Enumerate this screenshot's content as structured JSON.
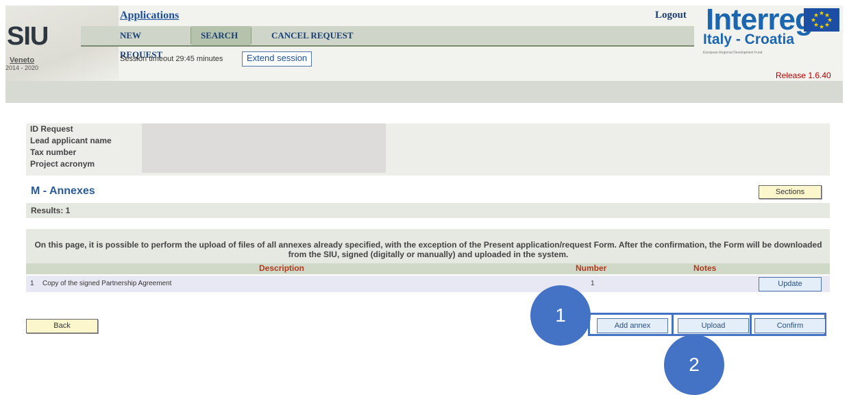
{
  "header": {
    "logo": "SIU",
    "region": "Veneto",
    "years": "2014 - 2020",
    "app_link": "Applications",
    "logout": "Logout",
    "menu": [
      {
        "label": "NEW REQUEST"
      },
      {
        "label": "SEARCH"
      },
      {
        "label": "CANCEL REQUEST"
      }
    ],
    "session_text": "Session timeout 29:45 minutes",
    "extend_label": "Extend session",
    "programme_logo": "Interreg",
    "programme_sub": "Italy - Croatia",
    "programme_fund": "European Regional Development Fund",
    "release": "Release 1.6.40"
  },
  "request_info": {
    "labels": [
      "ID Request",
      "Lead applicant name",
      "Tax number",
      "Project acronym"
    ]
  },
  "section": {
    "title": "M - Annexes",
    "sections_button": "Sections",
    "results": "Results: 1"
  },
  "info_message": "On this page, it is possible to perform the upload of files of all annexes already specified, with the exception of the Present application/request Form. After the confirmation, the Form will be downloaded from the SIU, signed (digitally or manually) and uploaded in the system.",
  "table": {
    "headers": {
      "description": "Description",
      "number": "Number",
      "notes": "Notes"
    },
    "rows": [
      {
        "index": "1",
        "description": "Copy of the signed Partnership Agreement",
        "number": "1",
        "notes": "",
        "action": "Update"
      }
    ]
  },
  "actions": {
    "back": "Back",
    "add_annex": "Add annex",
    "upload": "Upload",
    "confirm": "Confirm"
  },
  "steps": {
    "step1": "1",
    "step2": "2"
  },
  "colors": {
    "accent": "#4472c4",
    "link": "#1b4f9a",
    "release": "#b00000",
    "header_text": "#b03a1c"
  }
}
